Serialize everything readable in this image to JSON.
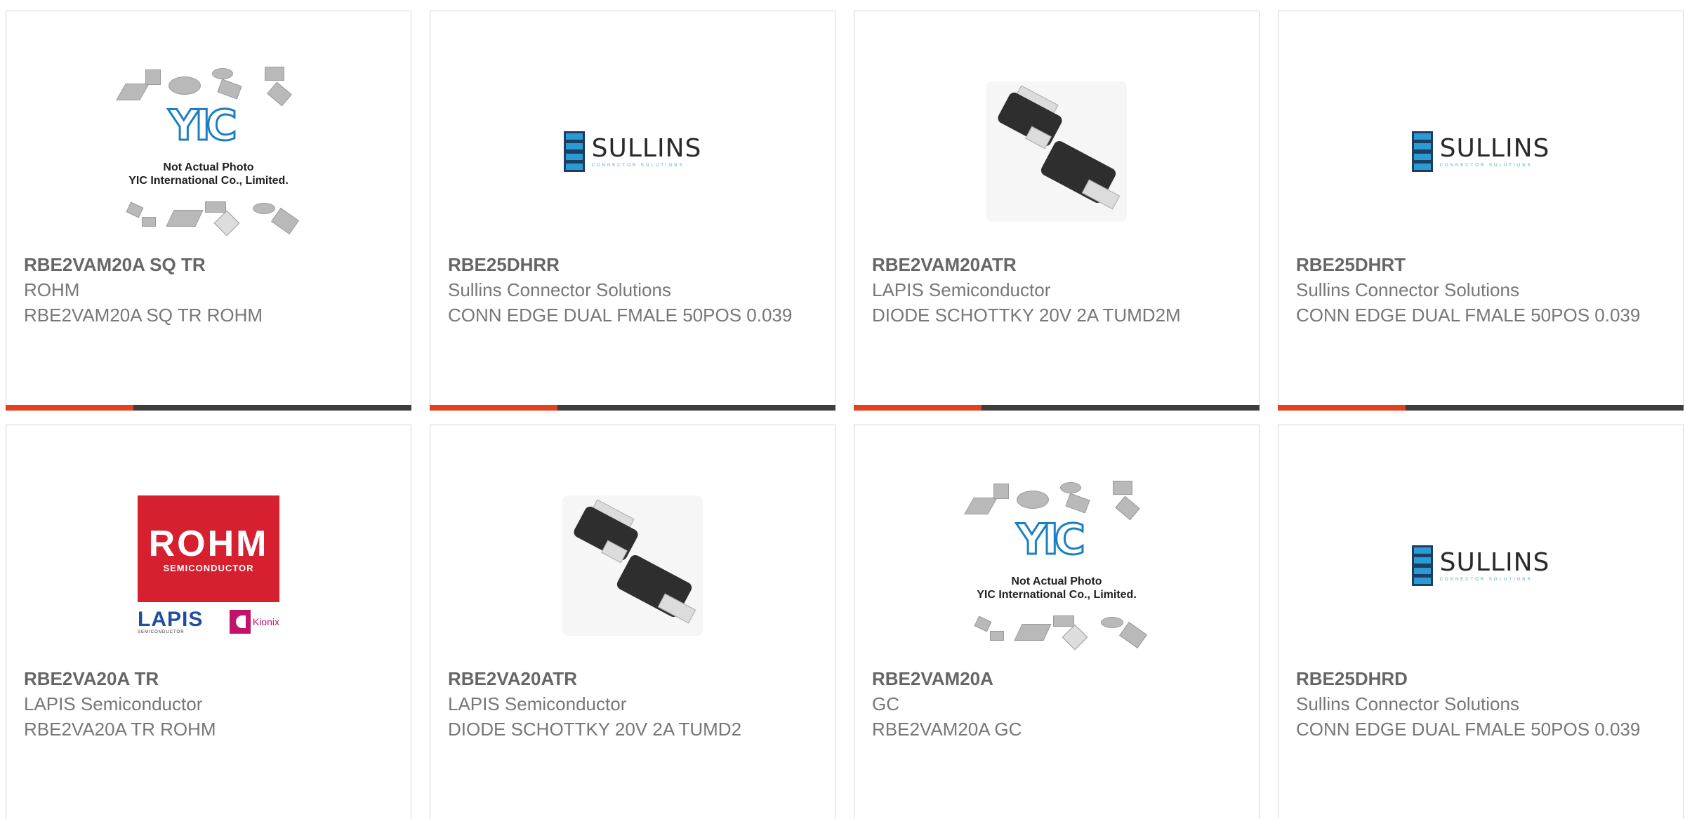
{
  "products": [
    {
      "part": "RBE2VAM20A SQ TR",
      "manufacturer": "ROHM",
      "description": "RBE2VAM20A SQ TR ROHM",
      "image": "not-actual-photo",
      "placeholder_lines": [
        "Not Actual Photo",
        "YIC International Co., Limited."
      ]
    },
    {
      "part": "RBE25DHRR",
      "manufacturer": "Sullins Connector Solutions",
      "description": "CONN EDGE DUAL FMALE 50POS 0.039",
      "image": "sullins-logo"
    },
    {
      "part": "RBE2VAM20ATR",
      "manufacturer": "LAPIS Semiconductor",
      "description": "DIODE SCHOTTKY 20V 2A TUMD2M",
      "image": "diode-package"
    },
    {
      "part": "RBE25DHRT",
      "manufacturer": "Sullins Connector Solutions",
      "description": "CONN EDGE DUAL FMALE 50POS 0.039",
      "image": "sullins-logo"
    },
    {
      "part": "RBE2VA20A TR",
      "manufacturer": "LAPIS Semiconductor",
      "description": "RBE2VA20A TR ROHM",
      "image": "rohm-lapis-logo"
    },
    {
      "part": "RBE2VA20ATR",
      "manufacturer": "LAPIS Semiconductor",
      "description": "DIODE SCHOTTKY 20V 2A TUMD2",
      "image": "diode-package"
    },
    {
      "part": "RBE2VAM20A",
      "manufacturer": "GC",
      "description": "RBE2VAM20A GC",
      "image": "not-actual-photo",
      "placeholder_lines": [
        "Not Actual Photo",
        "YIC International Co., Limited."
      ]
    },
    {
      "part": "RBE25DHRD",
      "manufacturer": "Sullins Connector Solutions",
      "description": "CONN EDGE DUAL FMALE 50POS 0.039",
      "image": "sullins-logo"
    }
  ],
  "logos": {
    "sullins": {
      "name": "SULLINS",
      "tagline": "CONNECTOR SOLUTIONS"
    },
    "rohm": {
      "name": "ROHM",
      "sub": "SEMICONDUCTOR"
    },
    "lapis": {
      "name": "LAPIS",
      "sub": "SEMICONDUCTOR"
    },
    "kionix": {
      "name": "Kionix"
    },
    "yic": {
      "name": "YIC"
    }
  },
  "colors": {
    "accent": "#e4401b",
    "bar": "#3d3d3d",
    "rohm_red": "#d6202f",
    "sullins_blue": "#2c9ad4"
  }
}
